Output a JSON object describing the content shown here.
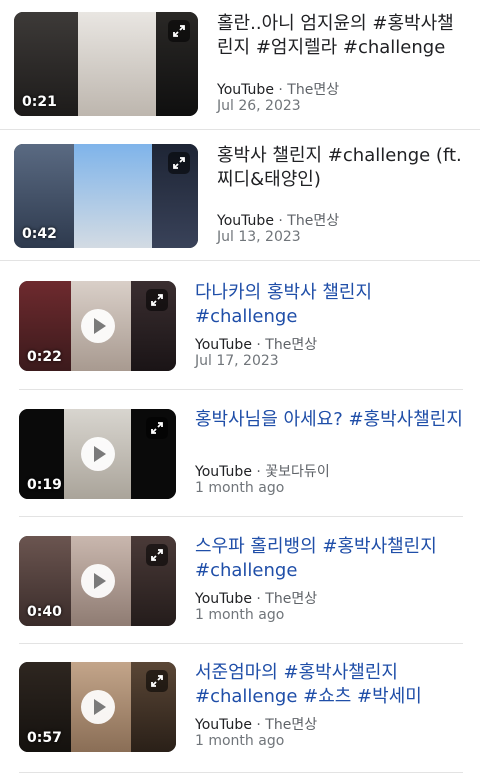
{
  "results": [
    {
      "title": "홀란..아니 엄지윤의 #홍박사챌린지 #엄지렐라 #challenge",
      "title_color": "#202124",
      "source": "YouTube",
      "separator": " · ",
      "channel": "The면상",
      "date": "Jul 26, 2023",
      "duration": "0:21",
      "has_play_button": false
    },
    {
      "title": "홍박사 챌린지 #challenge (ft. 찌디&태양인)",
      "title_color": "#202124",
      "source": "YouTube",
      "separator": " · ",
      "channel": "The면상",
      "date": "Jul 13, 2023",
      "duration": "0:42",
      "has_play_button": false
    },
    {
      "title": "다나카의 홍박사 챌린지 #challenge",
      "title_color": "#1f4ea8",
      "source": "YouTube",
      "separator": " · ",
      "channel": "The면상",
      "date": "Jul 17, 2023",
      "duration": "0:22",
      "has_play_button": true
    },
    {
      "title": "홍박사님을 아세요? #홍박사챌린지",
      "title_color": "#1f4ea8",
      "source": "YouTube",
      "separator": " · ",
      "channel": "꽃보다듀이",
      "date": "1 month ago",
      "duration": "0:19",
      "has_play_button": true
    },
    {
      "title": "스우파 홀리뱅의 #홍박사챌린지 #challenge",
      "title_color": "#1f4ea8",
      "source": "YouTube",
      "separator": " · ",
      "channel": "The면상",
      "date": "1 month ago",
      "duration": "0:40",
      "has_play_button": true
    },
    {
      "title": "서준엄마의 #홍박사챌린지 #challenge #쇼츠 #박세미",
      "title_color": "#1f4ea8",
      "source": "YouTube",
      "separator": " · ",
      "channel": "The면상",
      "date": "1 month ago",
      "duration": "0:57",
      "has_play_button": true
    }
  ],
  "icons": {
    "expand": "expand-icon",
    "play": "play-icon"
  }
}
